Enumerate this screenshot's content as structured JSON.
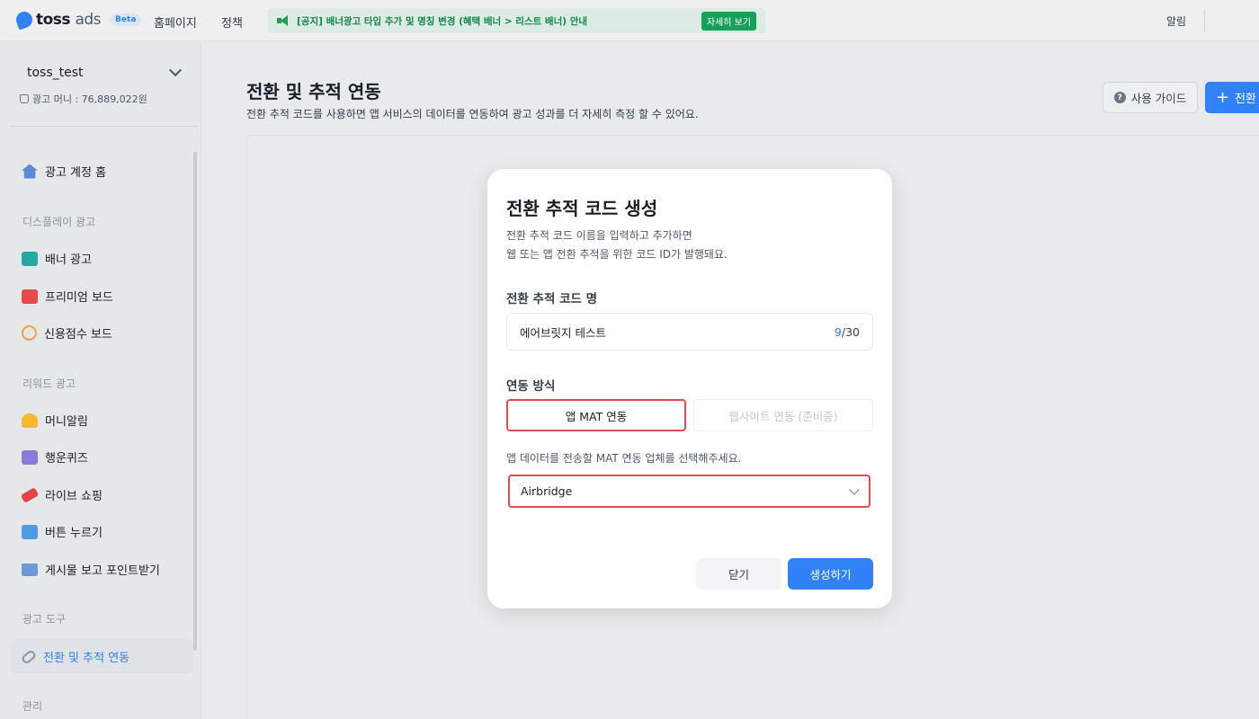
{
  "topbar": {
    "logo_main": "toss",
    "logo_sub": "ads",
    "beta": "Beta",
    "nav": [
      "홈페이지",
      "정책"
    ],
    "notice_text": "[공지] 배너광고 타입 추가 및 명칭 변경 (혜택 배너 > 리스트 배너) 안내",
    "notice_button": "자세히 보기",
    "alarm": "알림"
  },
  "sidebar": {
    "account": "toss_test",
    "money": "광고 머니 : 76,889,022원",
    "home": "광고 계정 홈",
    "sections": {
      "display": "디스플레이 광고",
      "reward": "리워드 광고",
      "tools": "광고 도구",
      "manage": "관리"
    },
    "display_items": [
      "배너 광고",
      "프리미엄 보드",
      "신용점수 보드"
    ],
    "reward_items": [
      "머니알림",
      "행운퀴즈",
      "라이브 쇼핑",
      "버튼 누르기",
      "게시물 보고 포인트받기"
    ],
    "tools_items": [
      "전환 및 추적 연동"
    ]
  },
  "main": {
    "title": "전환 및 추적 연동",
    "subtitle": "전환 추적 코드를 사용하면 앱 서비스의 데이터를 연동하여 광고 성과를 더 자세히 측정 할 수 있어요.",
    "guide_button": "사용 가이드",
    "new_button": "전환"
  },
  "modal": {
    "title": "전환 추적 코드 생성",
    "desc_line1": "전환 추적 코드 이름을 입력하고 추가하면",
    "desc_line2": "웹 또는 앱 전환 추적을 위한 코드 ID가 발행돼요.",
    "name_label": "전환 추적 코드 명",
    "name_value": "에어브릿지 테스트",
    "count_current": "9",
    "count_max": "/30",
    "method_label": "연동 방식",
    "method_app": "앱 MAT 연동",
    "method_web": "웹사이트 연동 (준비중)",
    "select_help": "앱 데이터를 전송할 MAT 연동 업체를 선택해주세요.",
    "select_value": "Airbridge",
    "close_button": "닫기",
    "create_button": "생성하기"
  },
  "colors": {
    "primary": "#3182f6",
    "highlight_border": "#e5484d",
    "notice_green": "#17a05a"
  }
}
